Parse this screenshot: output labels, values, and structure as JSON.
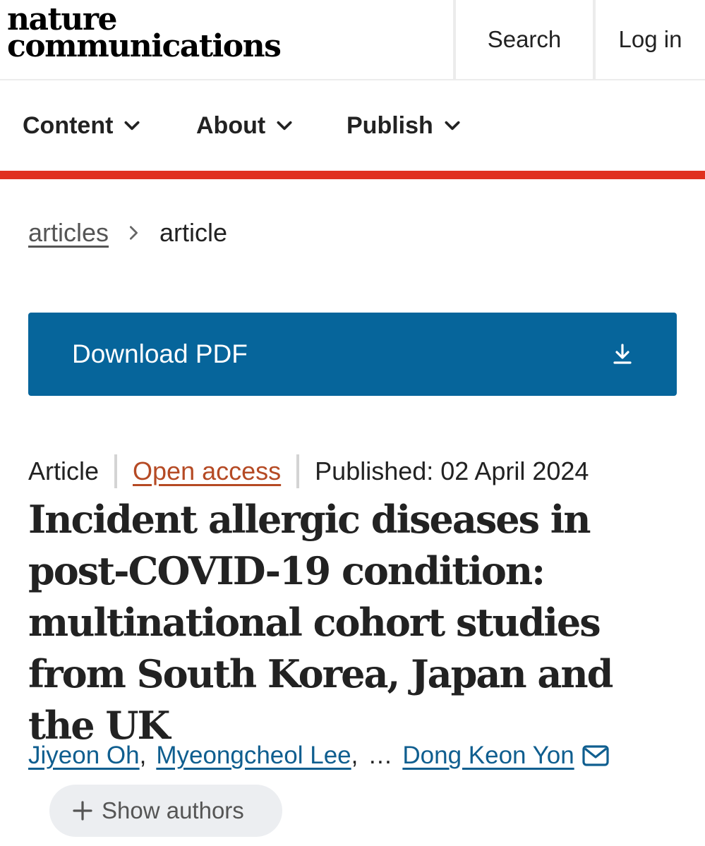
{
  "header": {
    "logo_line1": "nature",
    "logo_line2": "communications",
    "search_label": "Search",
    "login_label": "Log in"
  },
  "nav": {
    "items": [
      {
        "label": "Content",
        "icon": "chevron-down-icon"
      },
      {
        "label": "About",
        "icon": "chevron-down-icon"
      },
      {
        "label": "Publish",
        "icon": "chevron-down-icon"
      }
    ]
  },
  "breadcrumb": {
    "parent": "articles",
    "current": "article"
  },
  "download": {
    "label": "Download PDF",
    "icon": "download-icon"
  },
  "meta": {
    "type": "Article",
    "access": "Open access",
    "published": "Published: 02 April 2024"
  },
  "title": "Incident allergic diseases in post-COVID-19 condition: multinational cohort studies from South Korea, Japan and the UK",
  "authors": {
    "list": [
      "Jiyeon Oh",
      "Myeongcheol Lee",
      "Dong Keon Yon"
    ],
    "comma": ",",
    "ellipsis": "…",
    "show_label": "Show authors"
  },
  "colors": {
    "accent": "#e0311f",
    "download_bg": "#06659b",
    "link": "#0f5e8f",
    "open_access": "#b54a24"
  }
}
